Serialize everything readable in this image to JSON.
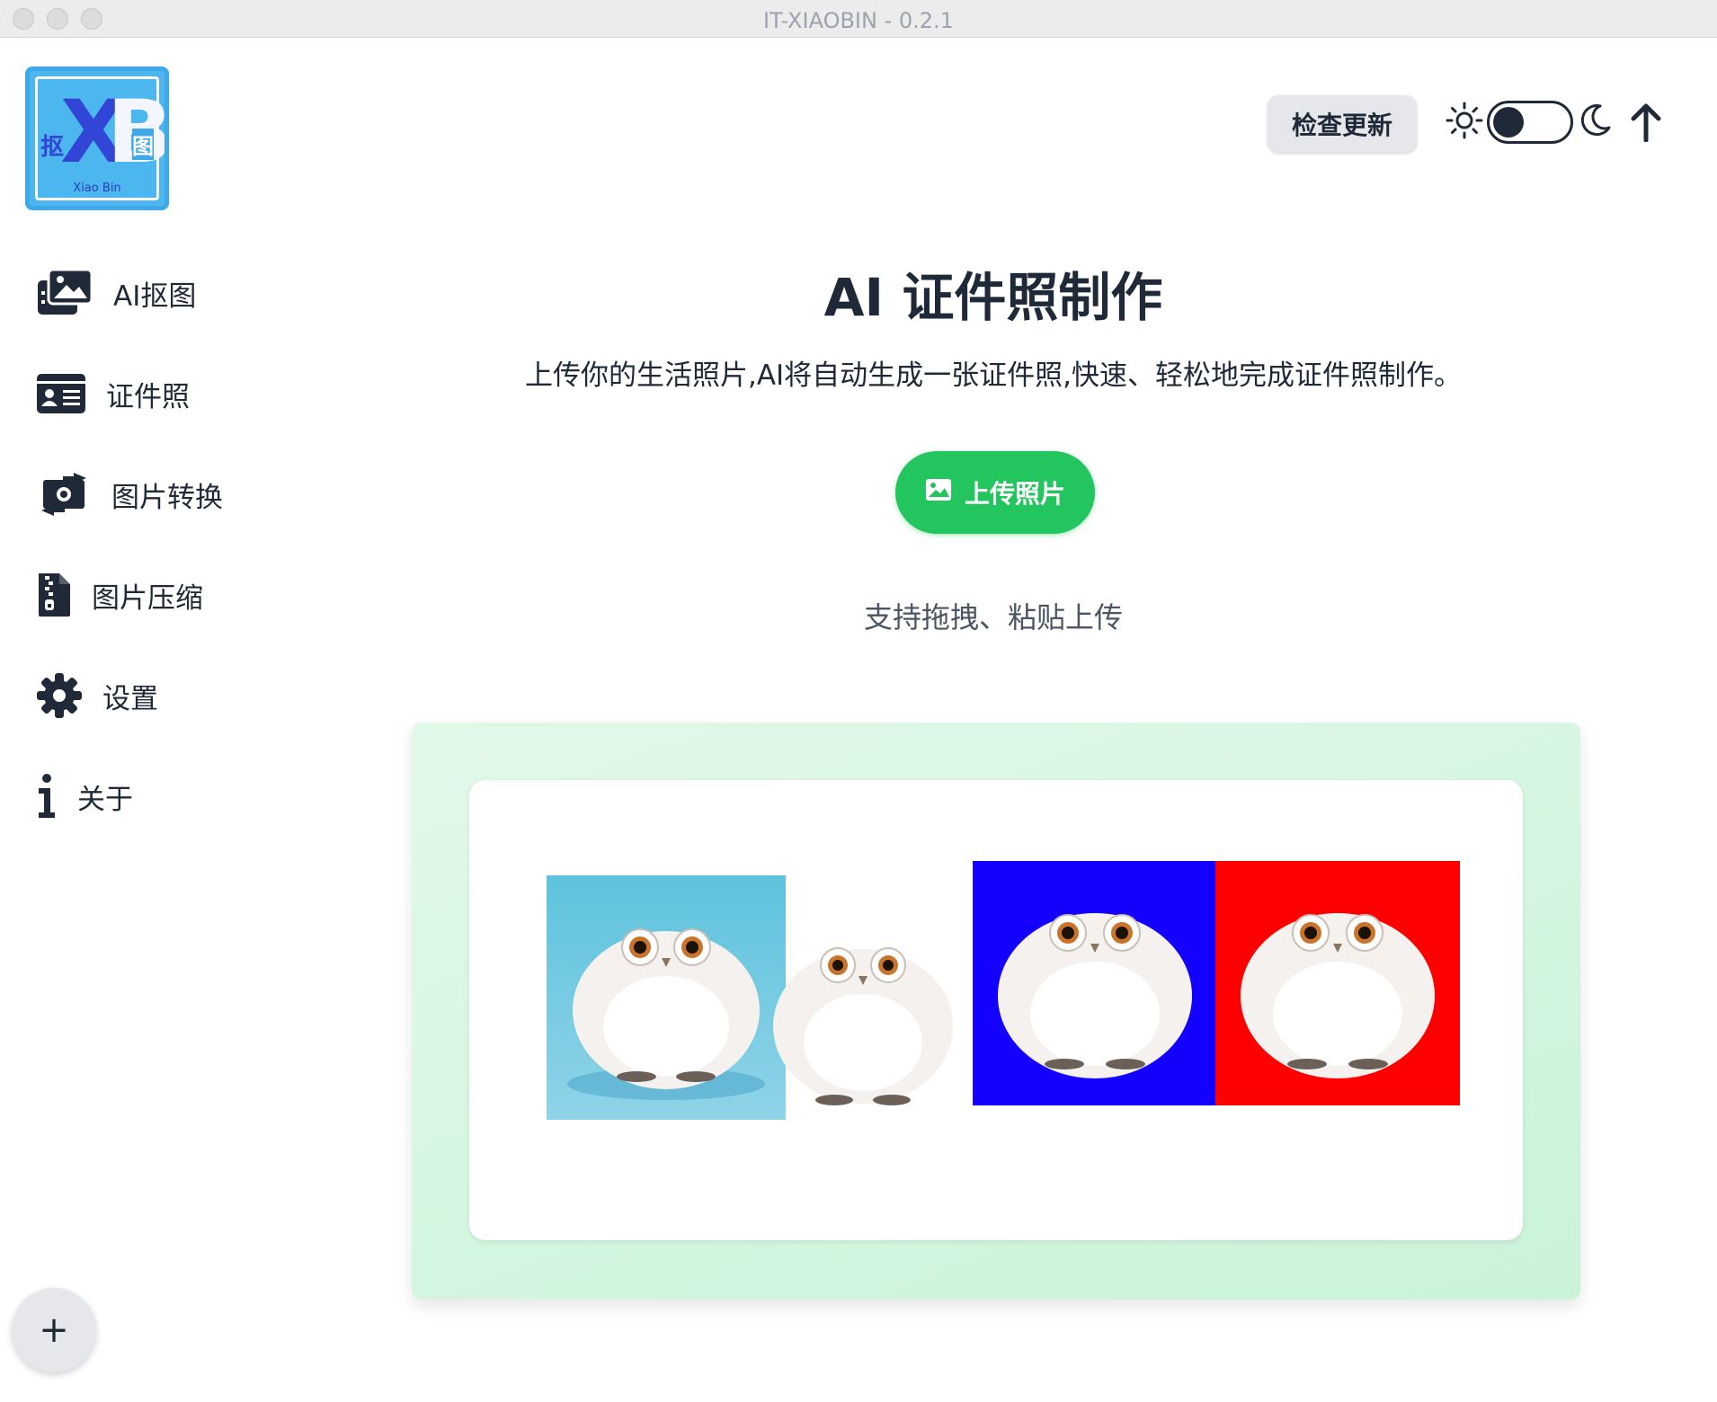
{
  "window": {
    "title": "IT-XIAOBIN - 0.2.1"
  },
  "logo": {
    "letters_x": "X",
    "letters_b": "B",
    "char_left": "抠",
    "char_right": "图",
    "tagline": "Xiao Bin"
  },
  "sidebar": {
    "items": [
      {
        "label": "AI抠图",
        "icon": "images-icon"
      },
      {
        "label": "证件照",
        "icon": "id-card-icon"
      },
      {
        "label": "图片转换",
        "icon": "money-bill-transfer-icon"
      },
      {
        "label": "图片压缩",
        "icon": "file-zipper-icon"
      },
      {
        "label": "设置",
        "icon": "gear-icon"
      },
      {
        "label": "关于",
        "icon": "info-icon"
      }
    ],
    "add_label": "+"
  },
  "topbar": {
    "check_update_label": "检查更新",
    "theme": {
      "light_icon": "sun-icon",
      "dark_icon": "moon-icon",
      "mode": "light"
    },
    "scroll_top_icon": "arrow-up-icon"
  },
  "main": {
    "title": "AI 证件照制作",
    "subtitle": "上传你的生活照片,AI将自动生成一张证件照,快速、轻松地完成证件照制作。",
    "upload_label": "上传照片",
    "hint": "支持拖拽、粘贴上传",
    "demo": {
      "samples": [
        {
          "background": "#5ec3dc",
          "kind": "original"
        },
        {
          "background": "transparent",
          "kind": "cutout"
        },
        {
          "background": "#1400ff",
          "kind": "blue-id"
        },
        {
          "background": "#ff0000",
          "kind": "red-id"
        }
      ]
    }
  },
  "colors": {
    "accent_green": "#22c55e",
    "text_dark": "#1f2937",
    "logo_blue": "#4cb6ef"
  }
}
